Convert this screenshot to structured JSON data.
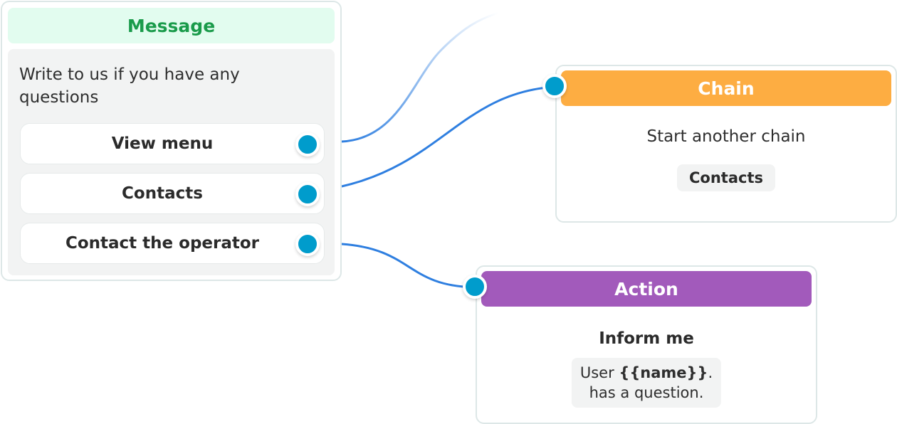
{
  "colors": {
    "wire": "#2f7fe0",
    "port": "#009ccc",
    "message_header_bg": "#e2fcef",
    "message_header_text": "#1a9b4b",
    "chain_header_bg": "#fdad42",
    "action_header_bg": "#a25abb"
  },
  "message_node": {
    "title": "Message",
    "text": "Write to us if you have any questions",
    "buttons": [
      {
        "label": "View menu"
      },
      {
        "label": "Contacts"
      },
      {
        "label": "Contact the operator"
      }
    ]
  },
  "chain_node": {
    "title": "Chain",
    "subtitle": "Start another chain",
    "chip": "Contacts"
  },
  "action_node": {
    "title": "Action",
    "subtitle": "Inform me",
    "chip_prefix": "User ",
    "chip_variable": "{{name}}",
    "chip_suffix": ".",
    "chip_line2": "has a question."
  },
  "connections": [
    {
      "from": "View menu",
      "to": "offscreen"
    },
    {
      "from": "Contacts",
      "to": "Chain"
    },
    {
      "from": "Contact the operator",
      "to": "Action"
    }
  ]
}
